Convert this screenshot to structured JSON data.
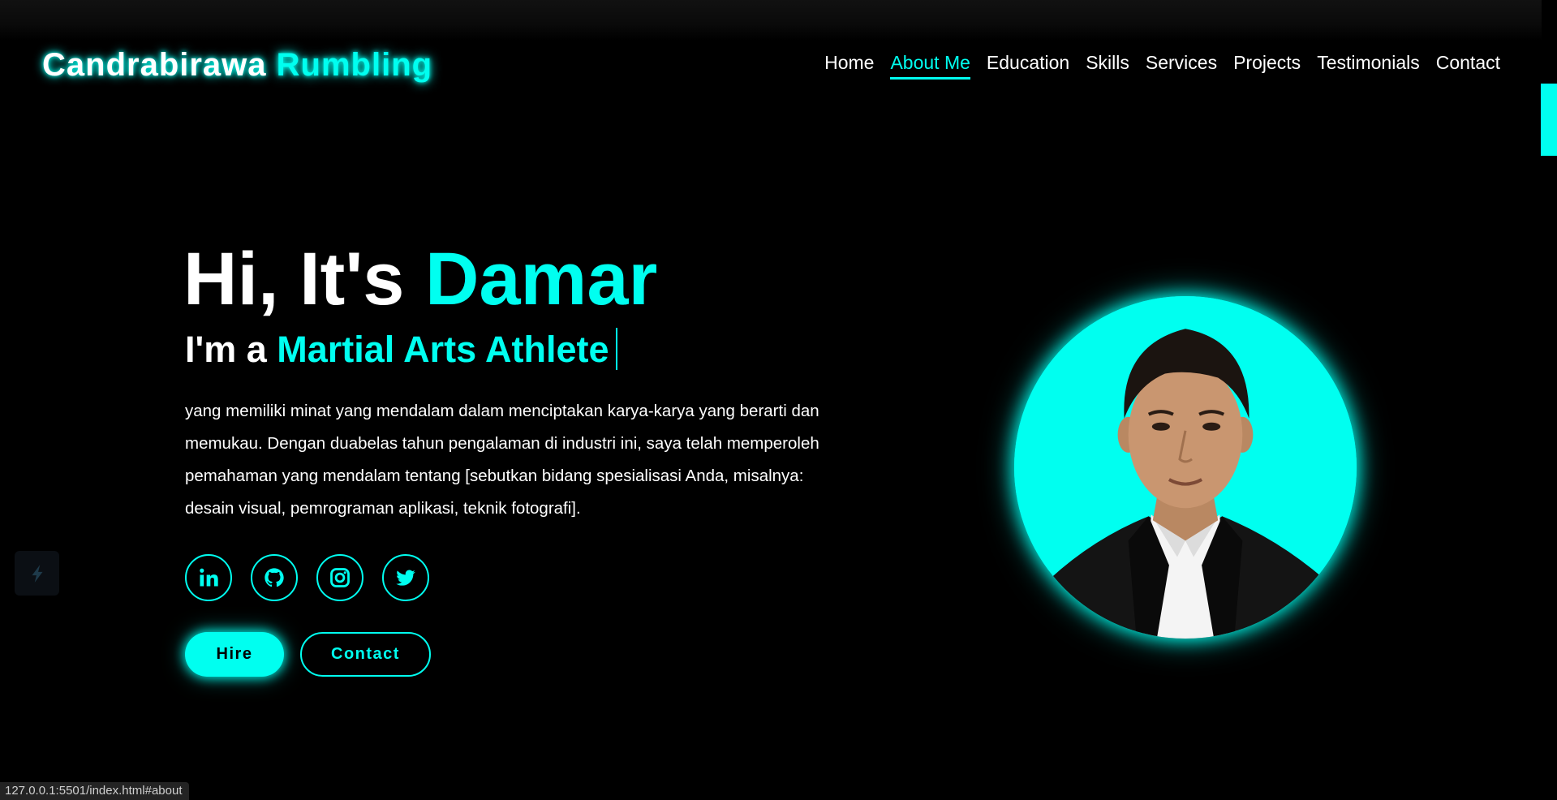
{
  "header": {
    "logo_part1": "Candrabirawa",
    "logo_part2": "Rumbling",
    "nav": [
      "Home",
      "About Me",
      "Education",
      "Skills",
      "Services",
      "Projects",
      "Testimonials",
      "Contact"
    ],
    "active_nav": "About Me"
  },
  "hero": {
    "greeting": "Hi, It's",
    "name": "Damar",
    "role_prefix": "I'm a",
    "role": "Martial Arts Athlete",
    "description": "yang memiliki minat yang mendalam dalam menciptakan karya-karya yang berarti dan memukau. Dengan duabelas tahun pengalaman di industri ini, saya telah memperoleh pemahaman yang mendalam tentang [sebutkan bidang spesialisasi Anda, misalnya: desain visual, pemrograman aplikasi, teknik fotografi].",
    "socials": [
      "linkedin-icon",
      "github-icon",
      "instagram-icon",
      "twitter-icon"
    ],
    "hire_label": "Hire",
    "contact_label": "Contact"
  },
  "status_bar": "127.0.0.1:5501/index.html#about",
  "colors": {
    "accent": "#00fff0",
    "background": "#000000"
  }
}
